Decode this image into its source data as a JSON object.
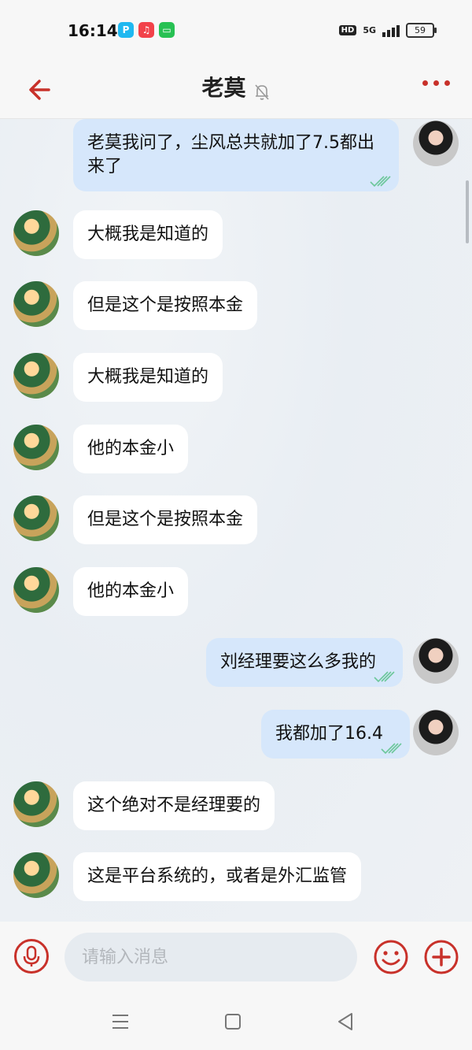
{
  "status": {
    "time": "16:14",
    "hd": "HD",
    "network": "5G",
    "battery": "59",
    "apps": [
      {
        "icon": "p-app-icon",
        "glyph": "P",
        "color": "#1fb8f0"
      },
      {
        "icon": "music-app-icon",
        "glyph": "♫",
        "color": "#f2424a"
      },
      {
        "icon": "message-app-icon",
        "glyph": "▭",
        "color": "#27c153"
      }
    ]
  },
  "header": {
    "title": "老莫",
    "accent": "#c8312a"
  },
  "messages": [
    {
      "side": "right",
      "text": "老莫我问了，尘风总共就加了7.5都出来了",
      "read": true
    },
    {
      "side": "left",
      "text": "大概我是知道的"
    },
    {
      "side": "left",
      "text": "但是这个是按照本金"
    },
    {
      "side": "left",
      "text": "大概我是知道的"
    },
    {
      "side": "left",
      "text": "他的本金小"
    },
    {
      "side": "left",
      "text": "但是这个是按照本金"
    },
    {
      "side": "left",
      "text": "他的本金小"
    },
    {
      "side": "right",
      "text": "刘经理要这么多我的",
      "read": true
    },
    {
      "side": "right",
      "text": "我都加了16.4",
      "read": true
    },
    {
      "side": "left",
      "text": "这个绝对不是经理要的"
    },
    {
      "side": "left",
      "text": "这是平台系统的，或者是外汇监管"
    }
  ],
  "input": {
    "placeholder": "请输入消息",
    "value": ""
  }
}
